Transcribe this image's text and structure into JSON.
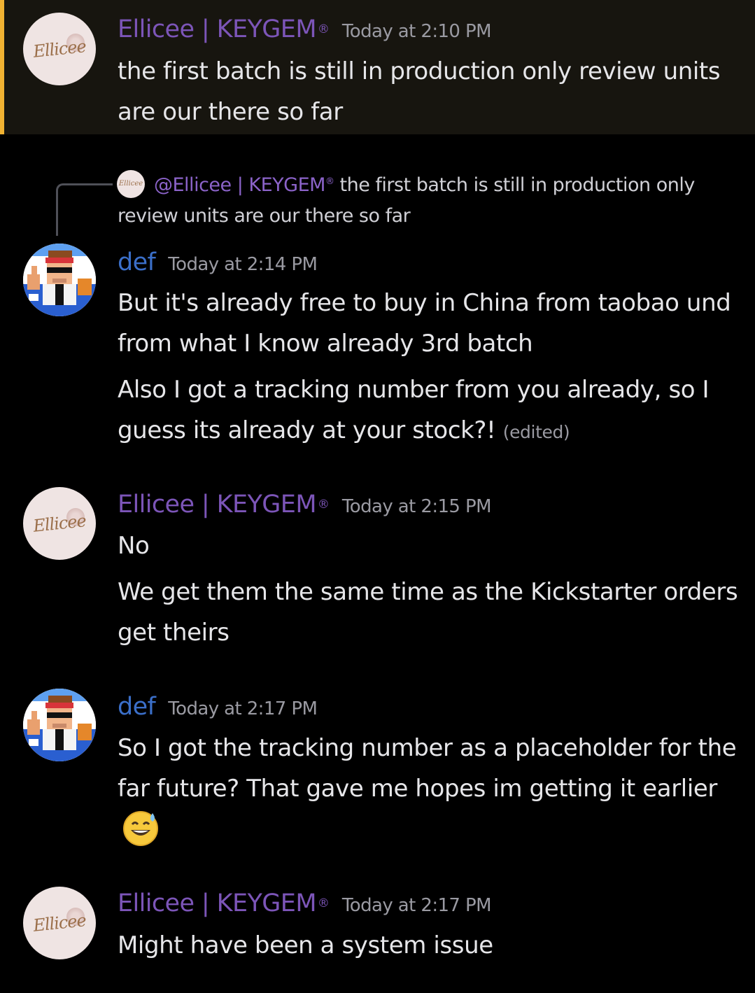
{
  "messages": [
    {
      "author": "Ellicee | KEYGEM",
      "badge": "®",
      "timestamp": "Today at 2:10 PM",
      "lines": [
        "the first batch is still in production only review units are our there so far"
      ]
    },
    {
      "reply": {
        "author": "@Ellicee | KEYGEM",
        "badge": "®",
        "text": "the first batch is still in production only review units are our there so far"
      },
      "author": "def",
      "timestamp": "Today at 2:14 PM",
      "lines": [
        "But it's already free to buy in China from taobao und from what I know already 3rd batch",
        "Also I got a tracking number from you already, so I guess its already at your stock?!"
      ],
      "edited": "(edited)"
    },
    {
      "author": "Ellicee | KEYGEM",
      "badge": "®",
      "timestamp": "Today at 2:15 PM",
      "lines": [
        "No",
        "We get them the same time as the Kickstarter orders get theirs"
      ]
    },
    {
      "author": "def",
      "timestamp": "Today at 2:17 PM",
      "lines": [
        "So I got the tracking number as a placeholder for the far future? That gave me hopes im getting it earlier"
      ],
      "emoji": "grinning-sweat-emoji"
    },
    {
      "author": "Ellicee | KEYGEM",
      "badge": "®",
      "timestamp": "Today at 2:17 PM",
      "lines": [
        "Might have been a system issue"
      ]
    }
  ],
  "avatars": {
    "ellicee_signature": "Ellicee"
  },
  "colors": {
    "background": "#000000",
    "highlight": "#17150f",
    "highlight_bar": "#f0b232",
    "ellicee_name": "#7c55b8",
    "def_name": "#3b6fc9",
    "timestamp": "#9a9aa2",
    "text": "#e6e6e9"
  }
}
